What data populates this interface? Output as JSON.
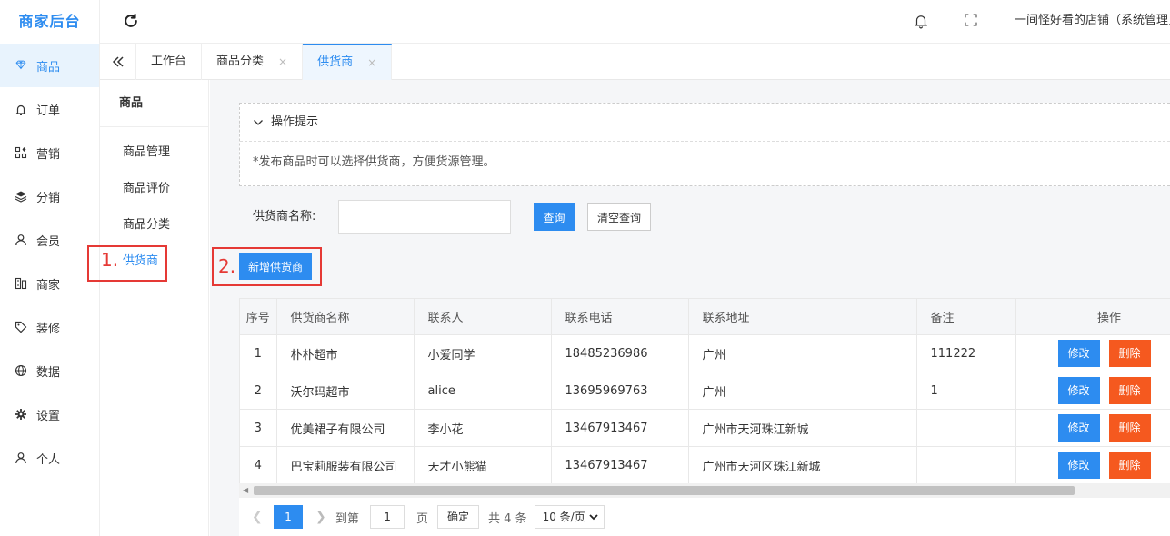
{
  "brand": "商家后台",
  "nav": [
    {
      "label": "商品",
      "icon": "diamond-icon",
      "active": true
    },
    {
      "label": "订单",
      "icon": "bell-icon"
    },
    {
      "label": "营销",
      "icon": "grid-icon"
    },
    {
      "label": "分销",
      "icon": "layers-icon"
    },
    {
      "label": "会员",
      "icon": "user-icon"
    },
    {
      "label": "商家",
      "icon": "store-icon"
    },
    {
      "label": "装修",
      "icon": "tag-icon"
    },
    {
      "label": "数据",
      "icon": "globe-icon"
    },
    {
      "label": "设置",
      "icon": "gear-icon"
    },
    {
      "label": "个人",
      "icon": "person-icon"
    }
  ],
  "header": {
    "shop_name": "一间怪好看的店铺（系统管理员）"
  },
  "tabs": [
    {
      "label": "工作台",
      "closable": false,
      "active": false
    },
    {
      "label": "商品分类",
      "closable": true,
      "active": false
    },
    {
      "label": "供货商",
      "closable": true,
      "active": true
    }
  ],
  "tab_close": "×",
  "subsidebar": {
    "title": "商品",
    "items": [
      {
        "label": "商品管理"
      },
      {
        "label": "商品评价"
      },
      {
        "label": "商品分类"
      },
      {
        "label": "供货商",
        "active": true
      }
    ]
  },
  "annotations": {
    "step1": "1.",
    "step2": "2."
  },
  "tips": {
    "title": "操作提示",
    "body": "*发布商品时可以选择供货商，方便货源管理。"
  },
  "search": {
    "label": "供货商名称:",
    "value": "",
    "placeholder": "",
    "query_label": "查询",
    "clear_label": "清空查询"
  },
  "add_button": "新增供货商",
  "table": {
    "columns": [
      "序号",
      "供货商名称",
      "联系人",
      "联系电话",
      "联系地址",
      "备注",
      "操作"
    ],
    "rows": [
      {
        "idx": "1",
        "name": "朴朴超市",
        "contact": "小爱同学",
        "phone": "18485236986",
        "address": "广州",
        "note": "111222"
      },
      {
        "idx": "2",
        "name": "沃尔玛超市",
        "contact": "alice",
        "phone": "13695969763",
        "address": "广州",
        "note": "1"
      },
      {
        "idx": "3",
        "name": "优美裙子有限公司",
        "contact": "李小花",
        "phone": "13467913467",
        "address": "广州市天河珠江新城",
        "note": ""
      },
      {
        "idx": "4",
        "name": "巴宝莉服装有限公司",
        "contact": "天才小熊猫",
        "phone": "13467913467",
        "address": "广州市天河区珠江新城",
        "note": ""
      }
    ],
    "edit_label": "修改",
    "delete_label": "删除"
  },
  "pagination": {
    "current_page": "1",
    "goto_label": "到第",
    "goto_value": "1",
    "page_label": "页",
    "confirm_label": "确定",
    "total_label": "共 4 条",
    "page_size": "10 条/页"
  },
  "colors": {
    "primary": "#2d8cf0",
    "danger": "#f5591f",
    "annotation": "#e53935"
  }
}
